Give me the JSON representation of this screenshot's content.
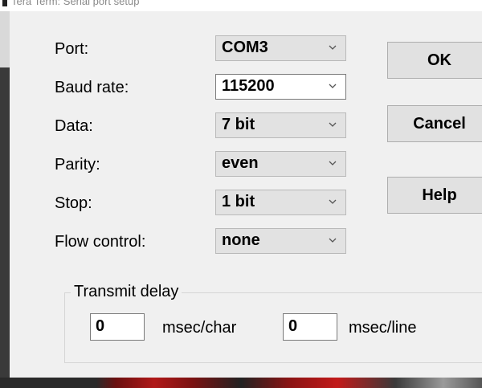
{
  "window": {
    "title": "Tera Term: Serial port setup"
  },
  "form": {
    "port": {
      "label": "Port:",
      "value": "COM3"
    },
    "baud_rate": {
      "label": "Baud rate:",
      "value": "115200"
    },
    "data": {
      "label": "Data:",
      "value": "7 bit"
    },
    "parity": {
      "label": "Parity:",
      "value": "even"
    },
    "stop": {
      "label": "Stop:",
      "value": "1 bit"
    },
    "flow_control": {
      "label": "Flow control:",
      "value": "none"
    }
  },
  "buttons": {
    "ok": "OK",
    "cancel": "Cancel",
    "help": "Help"
  },
  "transmit_delay": {
    "title": "Transmit delay",
    "char_value": "0",
    "char_unit": "msec/char",
    "line_value": "0",
    "line_unit": "msec/line"
  },
  "icons": {
    "dropdown": "chevron-down-icon",
    "window": "app-icon"
  },
  "colors": {
    "dialog_bg": "#f0f0f0",
    "button_bg": "#e1e1e1",
    "combo_bg": "#e2e2e2",
    "focused_bg": "#ffffff"
  }
}
